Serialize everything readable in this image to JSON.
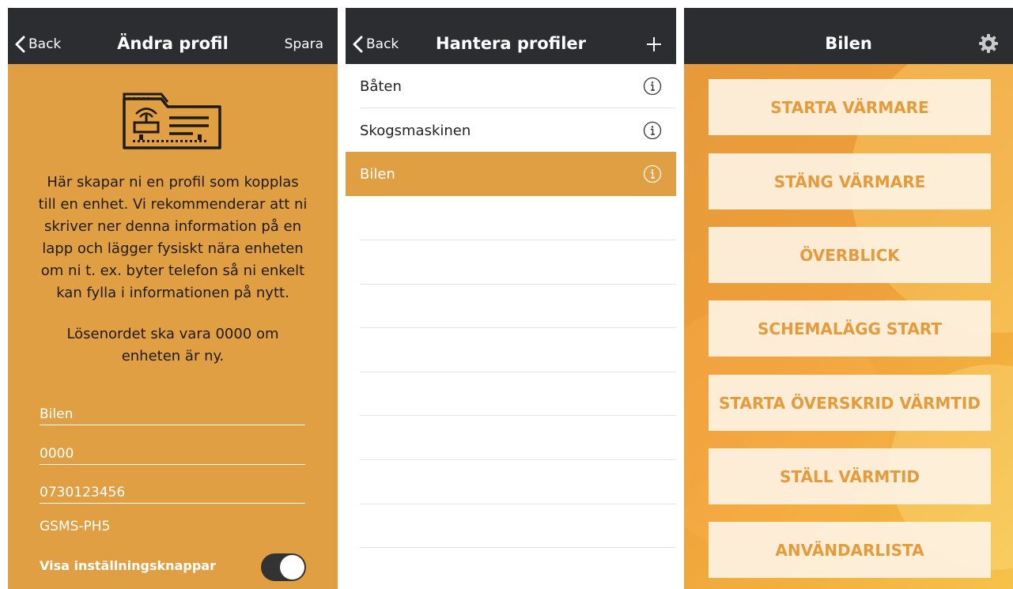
{
  "colors": {
    "navbar": "#2c2d31",
    "accent_orange": "#e19f43",
    "button_text": "#e59b3c",
    "button_bg": "#fdf1e0"
  },
  "edit_profile": {
    "back_label": "Back",
    "title": "Ändra profil",
    "save_label": "Spara",
    "icon": "router-device-icon",
    "intro_text": "Här skapar ni en profil som kopplas till en enhet. Vi rekommenderar att ni skriver ner denna information på en lapp och lägger fysiskt nära enheten om ni t. ex. byter telefon så ni enkelt kan fylla i informationen på nytt.",
    "password_note": "Lösenordet ska vara 0000 om enheten är ny.",
    "fields": {
      "name": "Bilen",
      "password": "0000",
      "phone": "0730123456"
    },
    "device_model": "GSMS-PH5",
    "toggle_label": "Visa inställningsknappar",
    "toggle_on": true
  },
  "manage_profiles": {
    "back_label": "Back",
    "title": "Hantera profiler",
    "add_icon": "plus-icon",
    "profiles": [
      {
        "name": "Båten",
        "selected": false
      },
      {
        "name": "Skogsmaskinen",
        "selected": false
      },
      {
        "name": "Bilen",
        "selected": true
      }
    ]
  },
  "vehicle": {
    "title": "Bilen",
    "settings_icon": "gear-icon",
    "buttons": [
      "STARTA VÄRMARE",
      "STÄNG VÄRMARE",
      "ÖVERBLICK",
      "SCHEMALÄGG START",
      "STARTA ÖVERSKRID VÄRMTID",
      "STÄLL VÄRMTID",
      "ANVÄNDARLISTA"
    ]
  }
}
